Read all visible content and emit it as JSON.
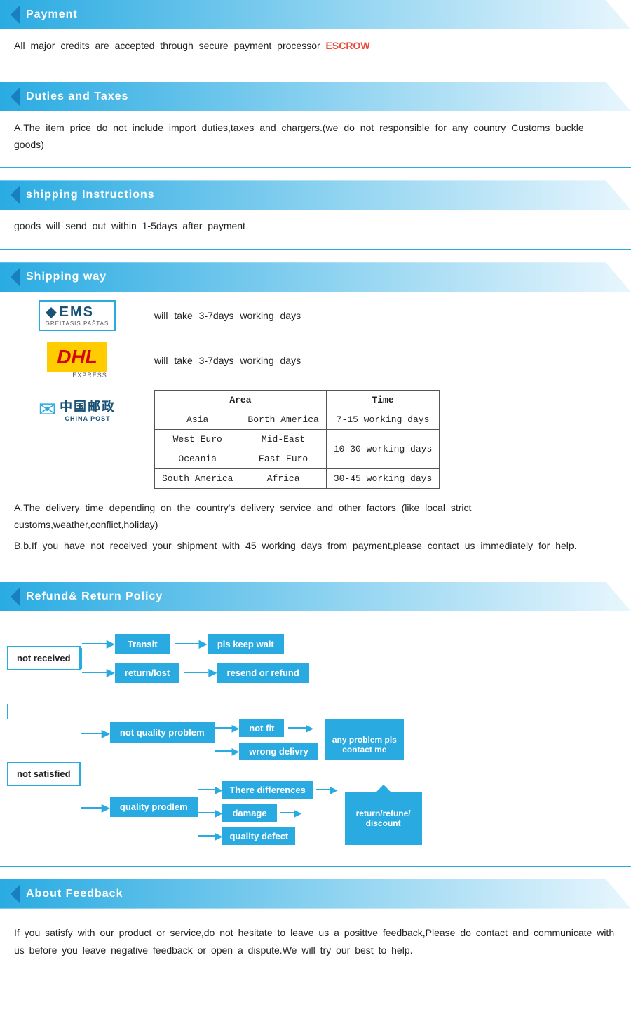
{
  "payment": {
    "title": "Payment",
    "body": "All  major  credits  are  accepted  through  secure  payment  processor",
    "highlight": "ESCROW"
  },
  "duties": {
    "title": "Duties  and  Taxes",
    "body": "A.The  item  price  do  not  include  import  duties,taxes  and  chargers.(we  do  not  responsible  for  any  country  Customs  buckle  goods)"
  },
  "shipping_instructions": {
    "title": "shipping  Instructions",
    "body": "goods  will  send  out  within  1-5days  after  payment"
  },
  "shipping_way": {
    "title": "Shipping  way",
    "ems_label": "will  take  3-7days  working  days",
    "dhl_label": "will  take  3-7days  working  days",
    "table": {
      "headers": [
        "Area",
        "",
        "Time"
      ],
      "rows": [
        [
          "Asia",
          "Borth America",
          "7-15 working days"
        ],
        [
          "West Euro",
          "Mid-East",
          "10-30 working days"
        ],
        [
          "Oceania",
          "East Euro",
          ""
        ],
        [
          "South America",
          "Africa",
          "30-45 working days"
        ]
      ]
    },
    "note_a": "A.The  delivery  time  depending  on  the  country's  delivery  service  and  other  factors  (like  local  strict   customs,weather,conflict,holiday)",
    "note_b": "B.b.If  you  have  not  received  your  shipment  with  45  working  days  from  payment,please  contact  us   immediately  for  help."
  },
  "refund": {
    "title": "Refund&  Return  Policy",
    "not_received": "not  received",
    "transit": "Transit",
    "return_lost": "return/lost",
    "pls_keep_wait": "pls  keep  wait",
    "resend_or_refund": "resend  or  refund",
    "not_satisfied": "not  satisfied",
    "not_quality_problem": "not  quality  problem",
    "not_fit": "not  fit",
    "wrong_delivery": "wrong  delivry",
    "there_differences": "There  differences",
    "quality_problem": "quality  prodlem",
    "damage": "damage",
    "quality_defect": "quality  defect",
    "any_problem": "any  problem  pls\ncontact  me",
    "return_refund": "return/refune/\ndiscount"
  },
  "feedback": {
    "title": "About  Feedback",
    "body": "If  you  satisfy  with  our  product  or  service,do  not  hesitate  to  leave  us  a  posittve  feedback,Please  do  contact  and  communicate  with  us  before  you  leave  negative  feedback  or  open  a  dispute.We  will  try  our  best  to  help."
  },
  "logos": {
    "ems": "EMS",
    "ems_sub": "GREITASIS PAŠTAS",
    "dhl": "DHL",
    "dhl_sub": "EXPRESS",
    "cp_cn": "中国邮政",
    "cp_en": "CHINA POST"
  }
}
